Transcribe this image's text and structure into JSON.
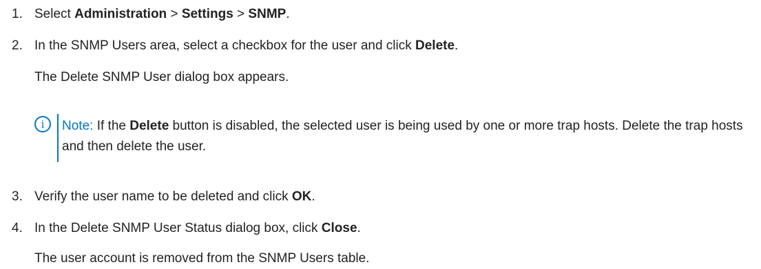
{
  "steps": [
    {
      "number": "1.",
      "prefix": "Select ",
      "path": [
        "Administration",
        "Settings",
        "SNMP"
      ],
      "separator": " > ",
      "suffix": "."
    },
    {
      "number": "2.",
      "text": "In the SNMP Users area, select a checkbox for the user and click ",
      "bold": "Delete",
      "suffix": ".",
      "result": "The Delete SNMP User dialog box appears."
    },
    {
      "number": "3.",
      "text": "Verify the user name to be deleted and click ",
      "bold": "OK",
      "suffix": "."
    },
    {
      "number": "4.",
      "text": "In the Delete SNMP User Status dialog box, click ",
      "bold": "Close",
      "suffix": ".",
      "result": "The user account is removed from the SNMP Users table."
    }
  ],
  "note": {
    "icon": "info-icon",
    "icon_glyph": "i",
    "label": "Note:",
    "text_before": " If the ",
    "bold": "Delete",
    "text_after": " button is disabled, the selected user is being used by one or more trap hosts. Delete the trap hosts and then delete the user.",
    "accent_color": "#0076ce"
  }
}
